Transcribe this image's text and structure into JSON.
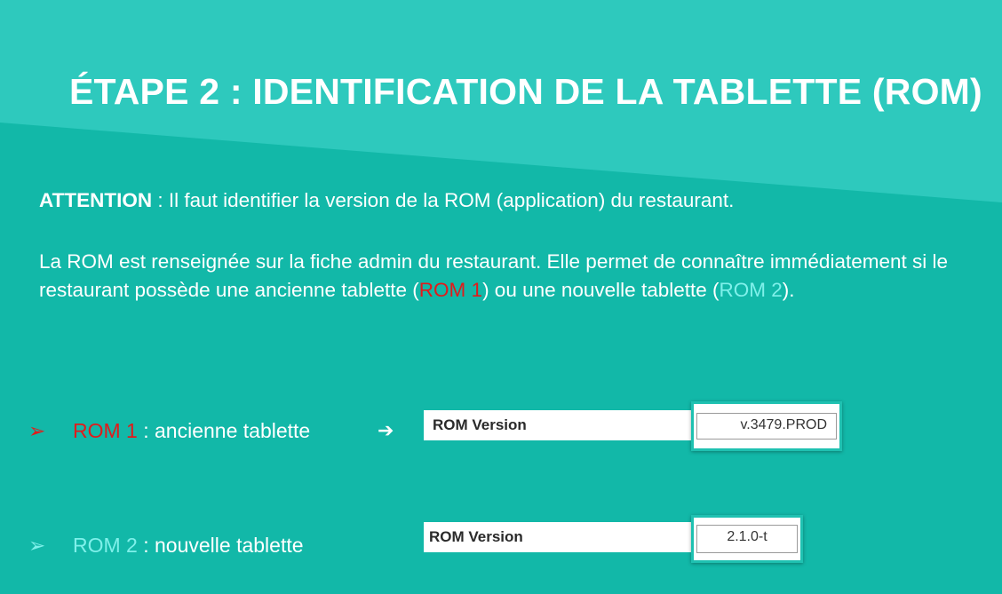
{
  "title": "ÉTAPE 2 : IDENTIFICATION DE LA TABLETTE (ROM)",
  "attention": {
    "label": "ATTENTION",
    "text": " : Il faut identifier la version de la ROM (application) du restaurant."
  },
  "info": {
    "text_1": "La ROM est renseignée sur la fiche admin du restaurant. Elle permet de connaître immédiatement si le restaurant possède une ancienne tablette (",
    "rom1": "ROM 1",
    "text_2": ") ou une nouvelle tablette (",
    "rom2": "ROM 2",
    "text_3": ")."
  },
  "rows": [
    {
      "bullet": "➢",
      "rom": "ROM 1",
      "desc": " : ancienne tablette",
      "arrow": "➔",
      "field_label": "ROM Version",
      "field_value": "v.3479.PROD"
    },
    {
      "bullet": "➢",
      "rom": "ROM 2",
      "desc": " : nouvelle tablette",
      "field_label": "ROM Version",
      "field_value": "2.1.0-t"
    }
  ],
  "colors": {
    "background": "#12b8a8",
    "header_band": "#2ec9bd",
    "rom1": "#e11b1b",
    "rom2": "#7ff0ea",
    "frame": "#1fc1b1"
  }
}
